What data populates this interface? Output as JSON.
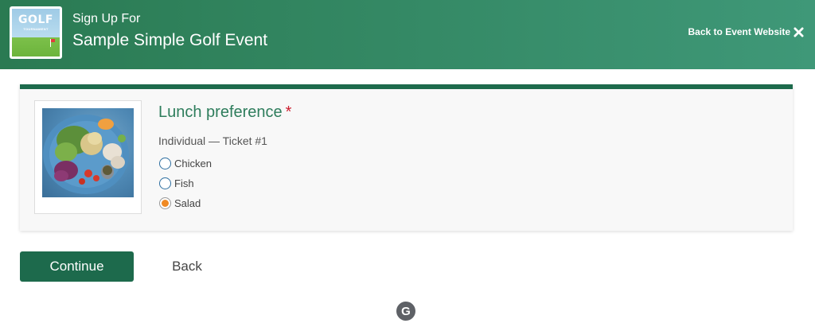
{
  "header": {
    "logo": {
      "word": "GOLF",
      "sub": "TOURNAMENT"
    },
    "subtitle": "Sign Up For",
    "title": "Sample Simple Golf Event",
    "back_link": "Back to Event Website",
    "back_icon": "close-icon"
  },
  "question": {
    "title": "Lunch preference",
    "required_mark": "*",
    "ticket_label": "Individual — Ticket #1",
    "options": [
      {
        "label": "Chicken",
        "selected": false
      },
      {
        "label": "Fish",
        "selected": false
      },
      {
        "label": "Salad",
        "selected": true
      }
    ],
    "image": "salad-photo"
  },
  "actions": {
    "continue_label": "Continue",
    "back_label": "Back"
  },
  "footer": {
    "brand_glyph": "G"
  },
  "colors": {
    "header_start": "#2a7a52",
    "header_end": "#3f9878",
    "accent": "#1d6a4c",
    "title": "#2e7d5c",
    "required": "#cc1f2f",
    "radio_selected": "#f08a24"
  }
}
